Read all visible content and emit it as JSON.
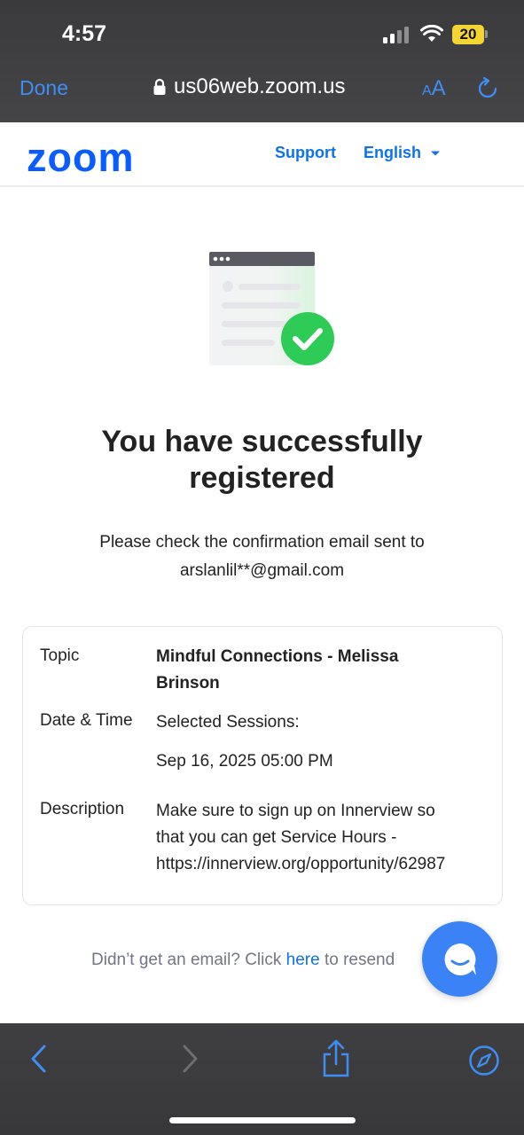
{
  "status_bar": {
    "time": "4:57",
    "battery": "20"
  },
  "browser": {
    "done_label": "Done",
    "url": "us06web.zoom.us",
    "text_size_small": "A",
    "text_size_large": "A"
  },
  "header": {
    "logo": "zoom",
    "support": "Support",
    "language": "English"
  },
  "main": {
    "headline": "You have successfully registered",
    "confirm_line1": "Please check the confirmation email sent to",
    "email": "arslanlil**@gmail.com"
  },
  "details": {
    "topic_label": "Topic",
    "topic_line1": "Mindful Connections - Melissa",
    "topic_line2": "Brinson",
    "datetime_label": "Date & Time",
    "sessions_label": "Selected Sessions:",
    "session_time": "Sep 16, 2025 05:00 PM",
    "description_label": "Description",
    "description_line1": "Make sure to sign up on Innerview so",
    "description_line2": "that you can get Service Hours -",
    "description_line3": "https://innerview.org/opportunity/62987"
  },
  "resend": {
    "prefix": "Didn’t get an email? Click ",
    "link": "here",
    "suffix": " to resend"
  },
  "colors": {
    "zoom_blue": "#0b5cff",
    "link_blue": "#0e72ed",
    "ios_blue": "#3f8ef5",
    "success_green": "#2ecc56"
  }
}
